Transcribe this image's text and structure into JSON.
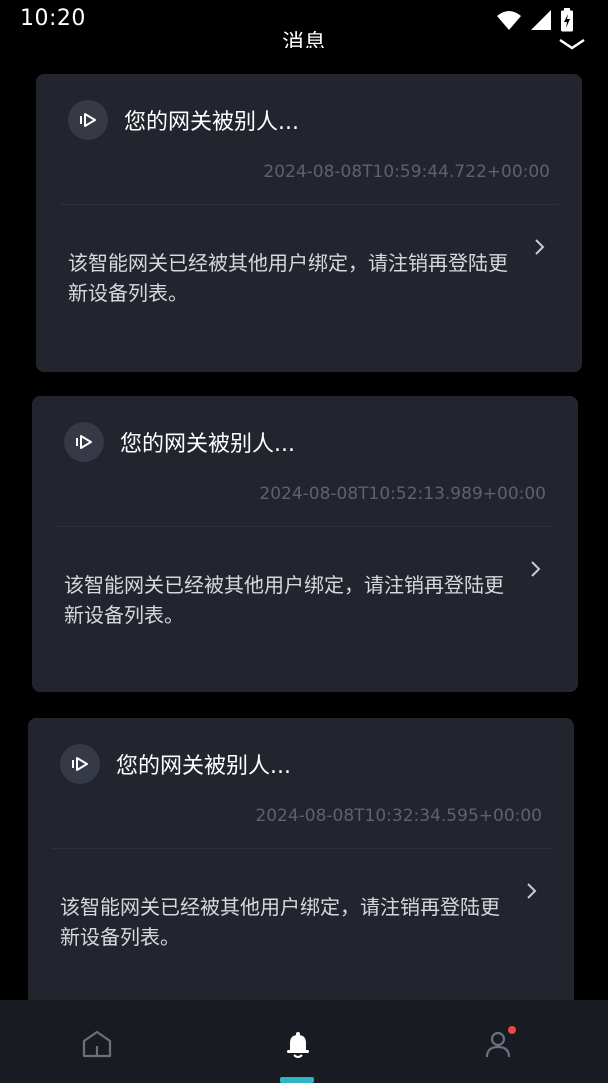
{
  "status_bar": {
    "time": "10:20"
  },
  "header": {
    "title": "消息"
  },
  "messages": [
    {
      "title": "您的网关被别人...",
      "time": "2024-08-08T10:59:44.722+00:00",
      "body": "该智能网关已经被其他用户绑定，请注销再登陆更新设备列表。"
    },
    {
      "title": "您的网关被别人...",
      "time": "2024-08-08T10:52:13.989+00:00",
      "body": "该智能网关已经被其他用户绑定，请注销再登陆更新设备列表。"
    },
    {
      "title": "您的网关被别人...",
      "time": "2024-08-08T10:32:34.595+00:00",
      "body": "该智能网关已经被其他用户绑定，请注销再登陆更新设备列表。"
    }
  ],
  "tabs": [
    {
      "icon": "home-icon",
      "active": false
    },
    {
      "icon": "bell-icon",
      "active": true
    },
    {
      "icon": "user-icon",
      "active": false,
      "badge": true
    }
  ],
  "colors": {
    "accent": "#2bb5c6",
    "card": "#22252e",
    "badge": "#e74b3c"
  }
}
